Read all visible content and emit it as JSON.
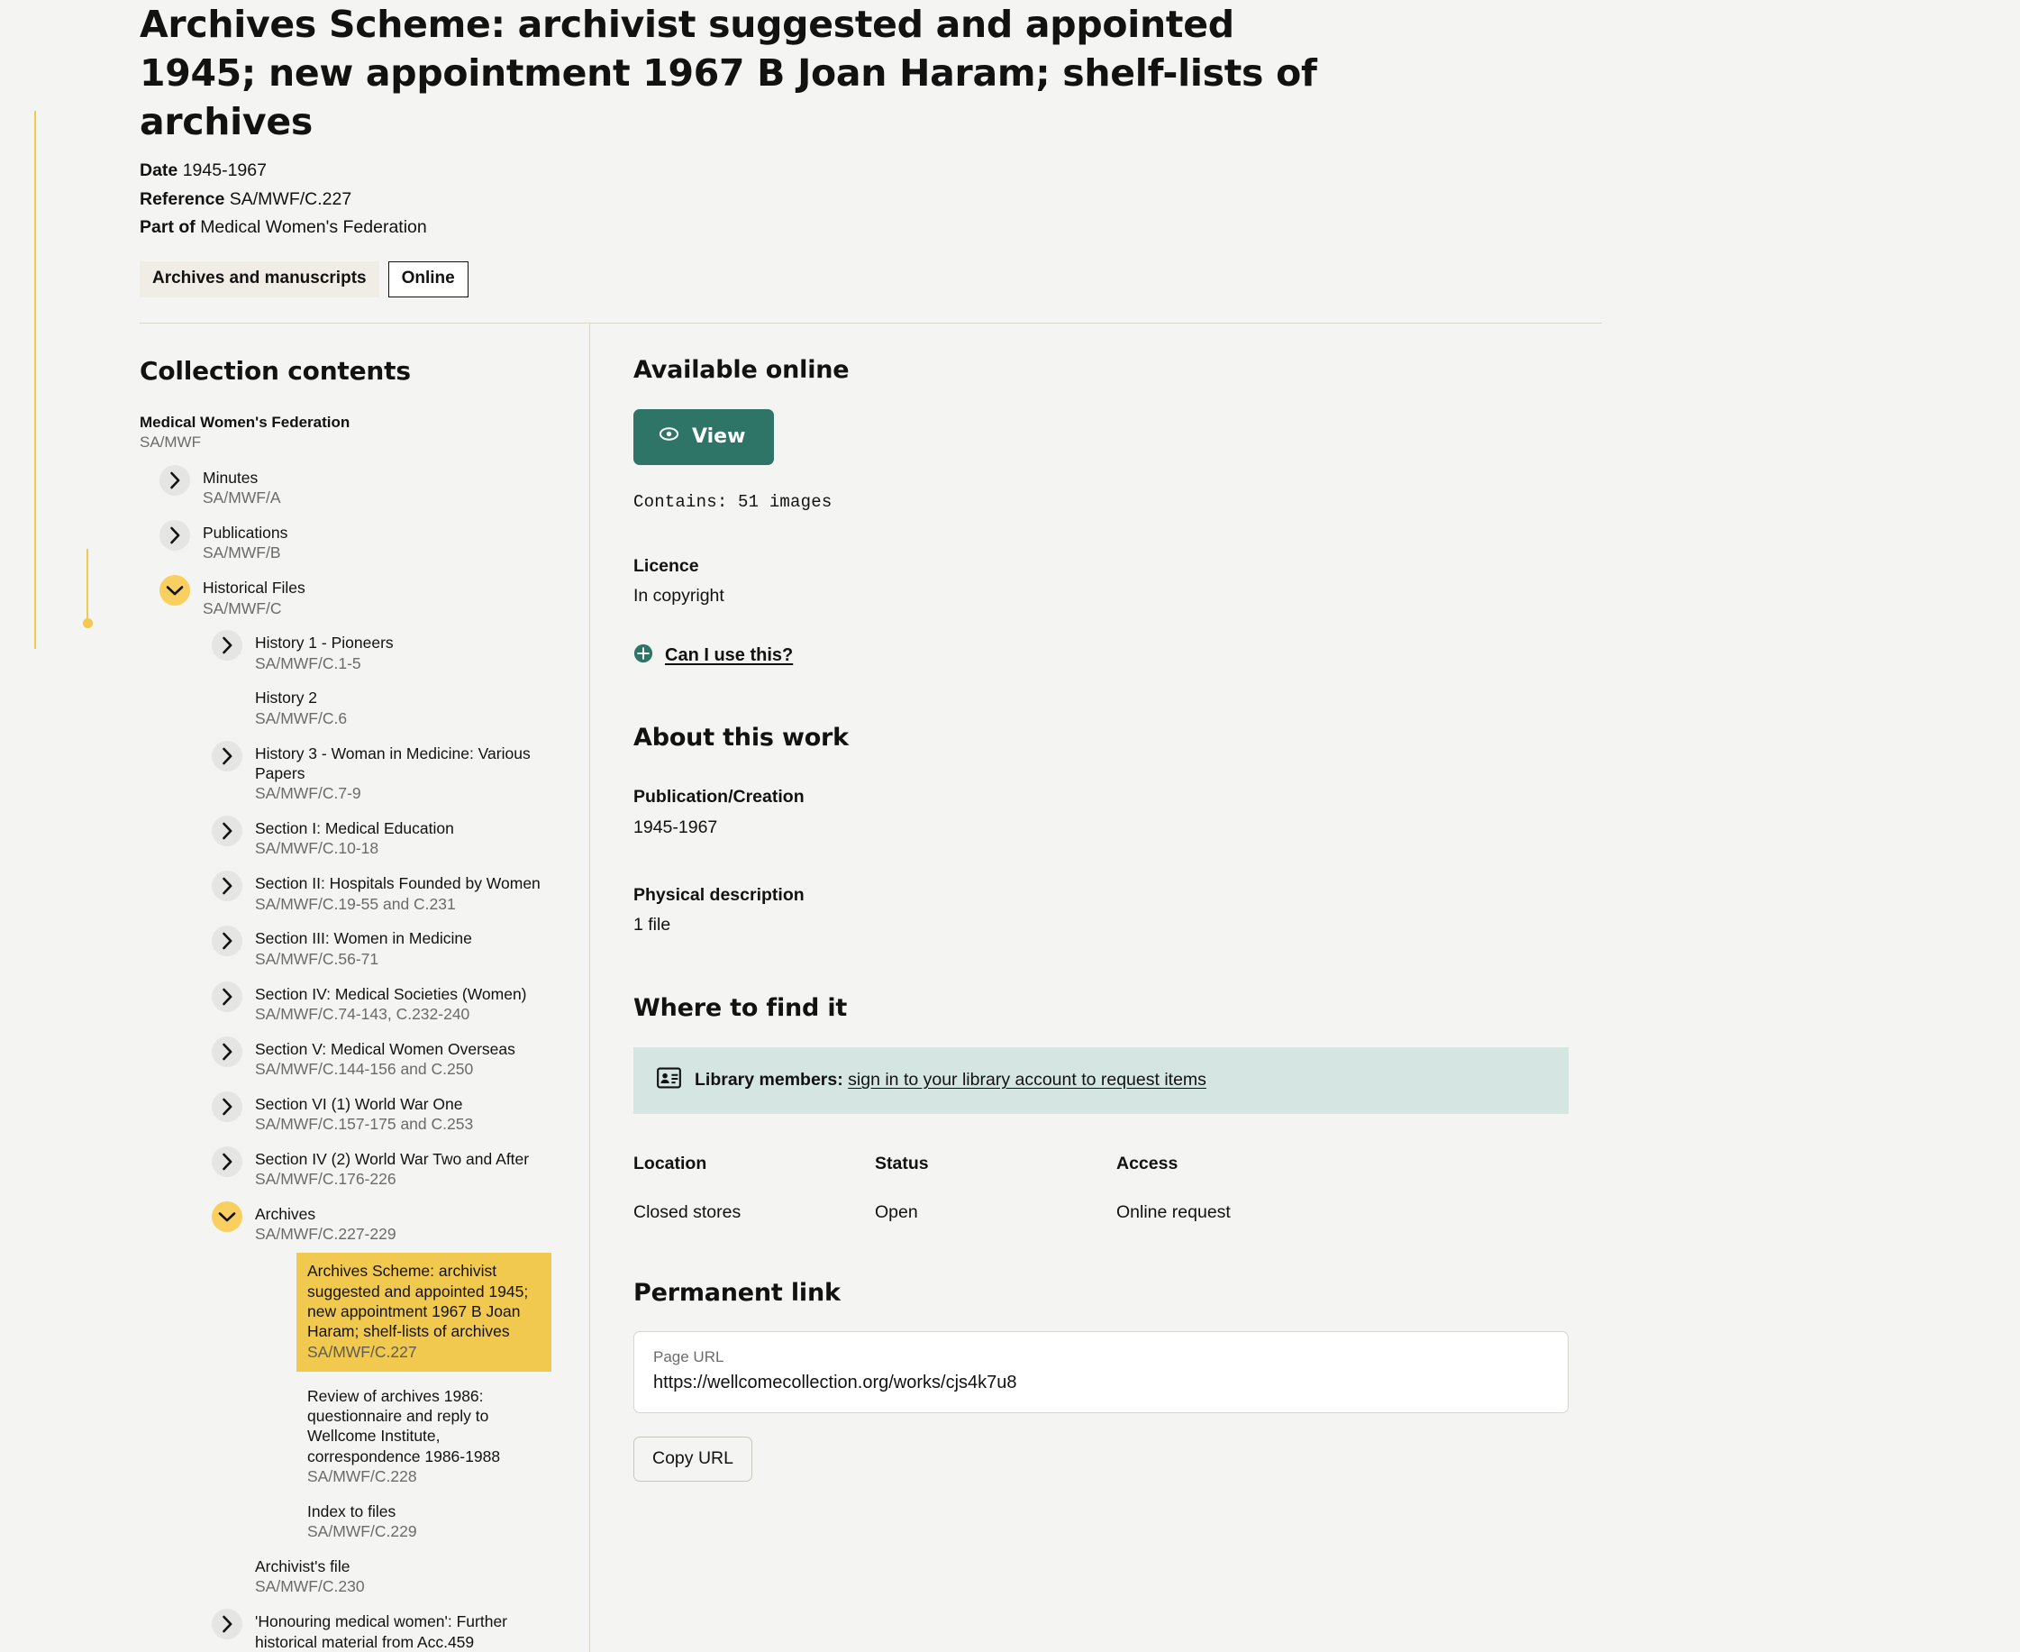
{
  "header": {
    "title": "Archives Scheme: archivist suggested and appointed 1945; new appointment 1967 B Joan Haram; shelf-lists of archives",
    "meta": [
      {
        "label": "Date",
        "value": "1945-1967"
      },
      {
        "label": "Reference",
        "value": "SA/MWF/C.227"
      },
      {
        "label": "Part of",
        "value": "Medical Women's Federation"
      }
    ],
    "badges": {
      "format": "Archives and manuscripts",
      "online": "Online"
    }
  },
  "collection": {
    "heading": "Collection contents",
    "root": {
      "label": "Medical Women's Federation",
      "ref": "SA/MWF"
    },
    "nodes": [
      {
        "label": "Minutes",
        "ref": "SA/MWF/A",
        "indent": 1,
        "toggle": "closed"
      },
      {
        "label": "Publications",
        "ref": "SA/MWF/B",
        "indent": 1,
        "toggle": "closed"
      },
      {
        "label": "Historical Files",
        "ref": "SA/MWF/C",
        "indent": 1,
        "toggle": "open"
      },
      {
        "label": "History 1 - Pioneers",
        "ref": "SA/MWF/C.1-5",
        "indent": 2,
        "toggle": "closed"
      },
      {
        "label": "History 2",
        "ref": "SA/MWF/C.6",
        "indent": 2,
        "toggle": "none"
      },
      {
        "label": "History 3 - Woman in Medicine: Various Papers",
        "ref": "SA/MWF/C.7-9",
        "indent": 2,
        "toggle": "closed"
      },
      {
        "label": "Section I: Medical Education",
        "ref": "SA/MWF/C.10-18",
        "indent": 2,
        "toggle": "closed"
      },
      {
        "label": "Section II: Hospitals Founded by Women",
        "ref": "SA/MWF/C.19-55 and C.231",
        "indent": 2,
        "toggle": "closed"
      },
      {
        "label": "Section III: Women in Medicine",
        "ref": "SA/MWF/C.56-71",
        "indent": 2,
        "toggle": "closed"
      },
      {
        "label": "Section IV: Medical Societies (Women)",
        "ref": "SA/MWF/C.74-143, C.232-240",
        "indent": 2,
        "toggle": "closed"
      },
      {
        "label": "Section V: Medical Women Overseas",
        "ref": "SA/MWF/C.144-156 and C.250",
        "indent": 2,
        "toggle": "closed"
      },
      {
        "label": "Section VI (1) World War One",
        "ref": "SA/MWF/C.157-175 and C.253",
        "indent": 2,
        "toggle": "closed"
      },
      {
        "label": "Section IV (2) World War Two and After",
        "ref": "SA/MWF/C.176-226",
        "indent": 2,
        "toggle": "closed"
      },
      {
        "label": "Archives",
        "ref": "SA/MWF/C.227-229",
        "indent": 2,
        "toggle": "open"
      },
      {
        "label": "Archives Scheme: archivist suggested and appointed 1945; new appointment 1967 B Joan Haram; shelf-lists of archives",
        "ref": "SA/MWF/C.227",
        "indent": 3,
        "toggle": "none",
        "selected": true
      },
      {
        "label": "Review of archives 1986: questionnaire and reply to Wellcome Institute, correspondence 1986-1988",
        "ref": "SA/MWF/C.228",
        "indent": 3,
        "toggle": "none"
      },
      {
        "label": "Index to files",
        "ref": "SA/MWF/C.229",
        "indent": 3,
        "toggle": "none"
      },
      {
        "label": "Archivist's file",
        "ref": "SA/MWF/C.230",
        "indent": 2,
        "toggle": "none"
      },
      {
        "label": "'Honouring medical women': Further historical material from Acc.459",
        "ref": "",
        "indent": 2,
        "toggle": "closed"
      }
    ]
  },
  "available_online": {
    "heading": "Available online",
    "view_button": "View",
    "contains": "Contains: 51 images"
  },
  "licence": {
    "label": "Licence",
    "value": "In copyright",
    "can_i_use": "Can I use this?"
  },
  "about": {
    "heading": "About this work",
    "fields": [
      {
        "label": "Publication/Creation",
        "value": "1945-1967"
      },
      {
        "label": "Physical description",
        "value": "1 file"
      }
    ]
  },
  "where_to_find": {
    "heading": "Where to find it",
    "banner_prefix": "Library members:",
    "banner_link": "sign in to your library account to request items",
    "table": {
      "headers": [
        "Location",
        "Status",
        "Access"
      ],
      "row": [
        "Closed stores",
        "Open",
        "Online request"
      ]
    }
  },
  "permanent_link": {
    "heading": "Permanent link",
    "url_label": "Page URL",
    "url_value": "https://wellcomecollection.org/works/cjs4k7u8",
    "copy_button": "Copy URL"
  },
  "colors": {
    "accent_green": "#2e7467",
    "highlight_yellow": "#f2c94f",
    "banner_teal": "#d5e6e2",
    "badge_cream": "#efede6",
    "page_bg": "#f4f4f2"
  }
}
